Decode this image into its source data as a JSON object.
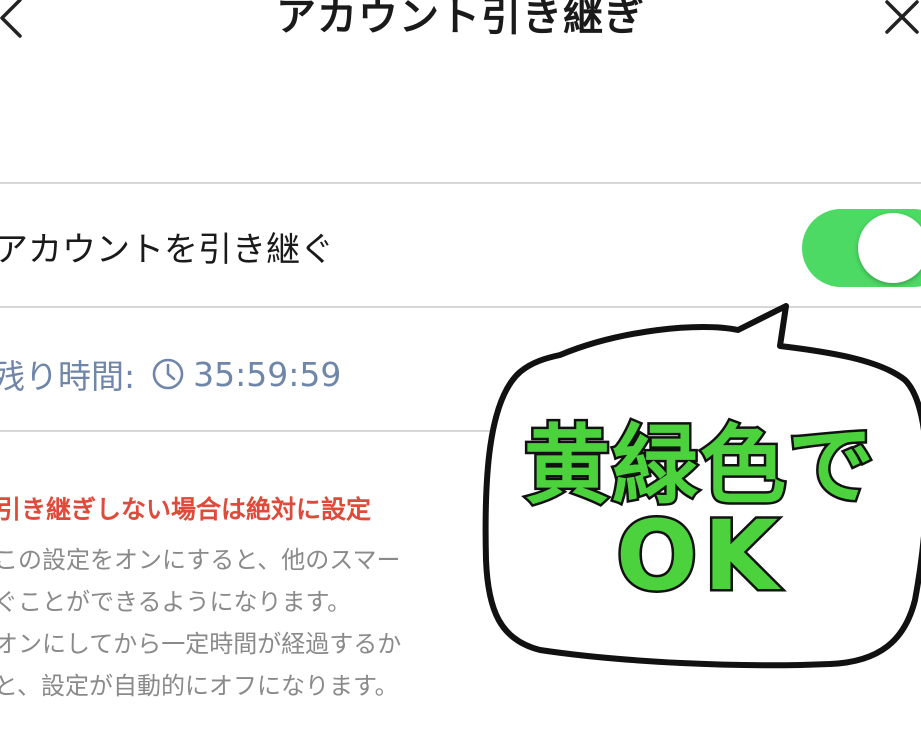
{
  "header": {
    "title": "アカウント引き継ぎ"
  },
  "transfer_row": {
    "label": "アカウントを引き継ぐ",
    "toggle_on": true,
    "toggle_color": "#4cd964"
  },
  "remaining": {
    "label": "残り時間:",
    "time": "35:59:59"
  },
  "warning": {
    "text": "引き継ぎしない場合は絶対に設定"
  },
  "description": {
    "lines": [
      "この設定をオンにすると、他のスマー",
      "ぐことができるようになります。",
      "オンにしてから一定時間が経過するか",
      "と、設定が自動的にオフになります。"
    ]
  },
  "callout": {
    "line1": "黄緑色で",
    "line2": "OK",
    "text_color": "#4cd23c"
  }
}
